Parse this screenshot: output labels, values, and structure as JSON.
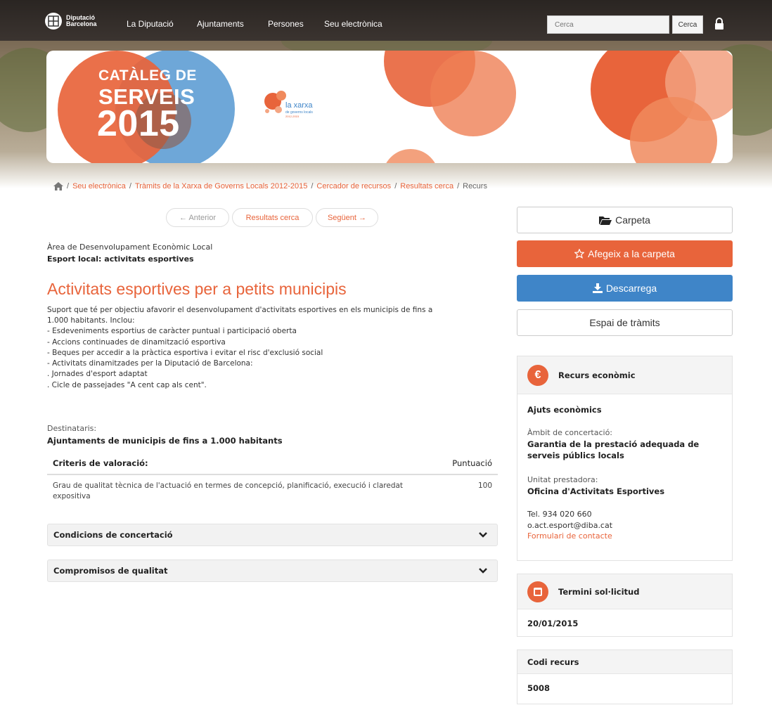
{
  "header": {
    "logo_line1": "Diputació",
    "logo_line2": "Barcelona",
    "nav": [
      "La Diputació",
      "Ajuntaments",
      "Persones",
      "Seu electrònica"
    ],
    "search_placeholder": "Cerca",
    "search_button": "Cerca"
  },
  "banner": {
    "title_line1": "CATÀLEG DE",
    "title_line2": "SERVEIS",
    "title_year": "2015",
    "xarxa_name": "la xarxa",
    "xarxa_sub": "de governs locals",
    "xarxa_years": "2012-2015"
  },
  "breadcrumb": {
    "items": [
      "Seu electrònica",
      "Tràmits de la Xarxa de Governs Locals 2012-2015",
      "Cercador de recursos",
      "Resultats cerca"
    ],
    "current": "Recurs"
  },
  "pager": {
    "prev": "← Anterior",
    "results": "Resultats cerca",
    "next": "Següent →"
  },
  "main": {
    "area": "Àrea de Desenvolupament Econòmic Local",
    "subject": "Esport local: activitats esportives",
    "title": "Activitats esportives per a petits municipis",
    "description_lines": [
      "Suport que té per objectiu afavorir el desenvolupament d'activitats esportives en els municipis de fins a",
      "1.000 habitants. Inclou:",
      "- Esdeveniments esportius de caràcter puntual i participació oberta",
      "- Accions continuades de dinamització esportiva",
      "- Beques per accedir a la pràctica esportiva i evitar el risc d'exclusió social",
      "- Activitats dinamitzades per la Diputació de Barcelona:",
      ". Jornades d'esport adaptat",
      ". Cicle de passejades \"A cent cap als cent\"."
    ],
    "destinataris_label": "Destinataris:",
    "destinataris_value": "Ajuntaments de municipis de fins a 1.000 habitants",
    "criteria": {
      "header_label": "Criteris de valoració:",
      "header_points": "Puntuació",
      "rows": [
        {
          "text": "Grau de qualitat tècnica de l'actuació en termes de concepció, planificació, execució i claredat expositiva",
          "points": "100"
        }
      ]
    },
    "accordions": [
      "Condicions de concertació",
      "Compromisos de qualitat"
    ]
  },
  "sidebar": {
    "folder_button": "Carpeta",
    "add_button": "Afegeix a la carpeta",
    "download_button": "Descarrega",
    "tramits_button": "Espai de tràmits",
    "resource_panel": {
      "icon_symbol": "€",
      "title": "Recurs econòmic",
      "type": "Ajuts econòmics",
      "ambit_label": "Àmbit de concertació:",
      "ambit_value": "Garantia de la prestació adequada de serveis públics locals",
      "unitat_label": "Unitat prestadora:",
      "unitat_value": "Oficina d'Activitats Esportives",
      "phone": "Tel. 934 020 660",
      "email": "o.act.esport@diba.cat",
      "contact_link": "Formulari de contacte"
    },
    "deadline_panel": {
      "title": "Termini sol·licitud",
      "value": "20/01/2015"
    },
    "code_panel": {
      "title": "Codi recurs",
      "value": "5008"
    }
  },
  "colors": {
    "accent": "#e8643b",
    "blue": "#3f85c8",
    "nav_bg": "#2f2a27"
  }
}
